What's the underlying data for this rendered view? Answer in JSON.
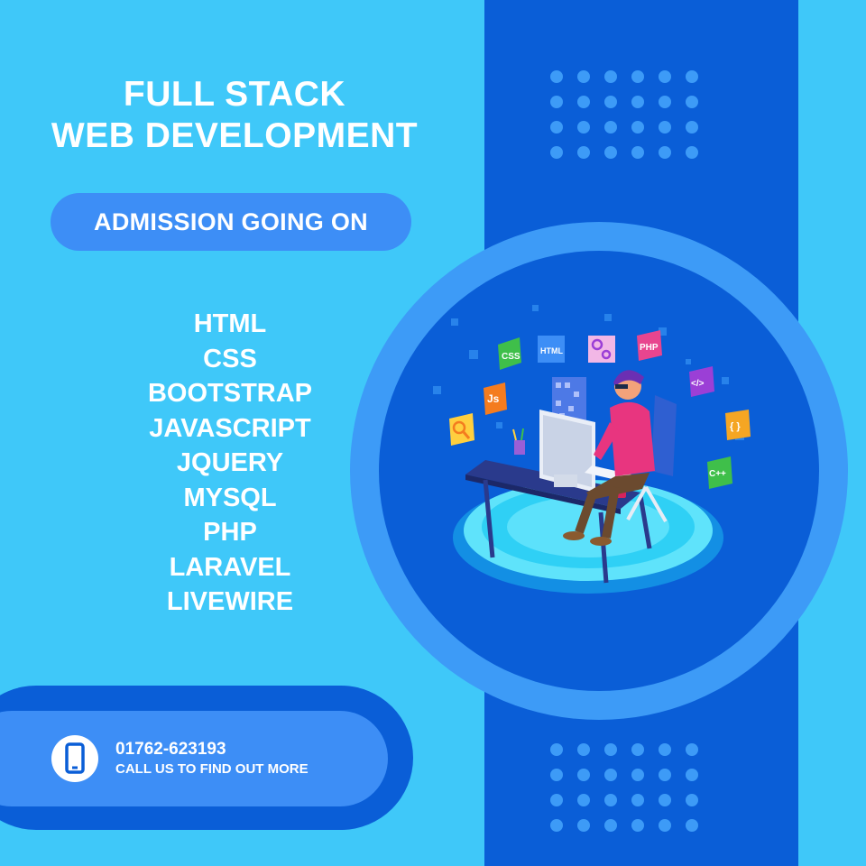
{
  "poster": {
    "title_line1": "FULL STACK",
    "title_line2": "WEB DEVELOPMENT",
    "admission_label": "ADMISSION GOING ON",
    "courses": [
      "HTML",
      "CSS",
      "BOOTSTRAP",
      "JAVASCRIPT",
      "JQUERY",
      "MYSQL",
      "PHP",
      "LARAVEL",
      "LIVEWIRE"
    ],
    "contact": {
      "phone": "01762-623193",
      "cta": "CALL US TO FIND OUT MORE",
      "icon": "mobile-phone-icon"
    },
    "illustration": {
      "badges": [
        {
          "label": "CSS",
          "color": "#3fbf4a"
        },
        {
          "label": "HTML",
          "color": "#3d8ef6"
        },
        {
          "label": "PHP",
          "color": "#e8458f"
        },
        {
          "label": "Js",
          "color": "#f47c1f"
        },
        {
          "label": "</>",
          "color": "#9b3fd6"
        },
        {
          "label": "{ }",
          "color": "#f5a623"
        },
        {
          "label": "C++",
          "color": "#3fbf4a"
        }
      ],
      "icons": [
        "gears-icon",
        "magnifier-icon"
      ]
    },
    "colors": {
      "background": "#3fc8f9",
      "dark_blue": "#0a5ed7",
      "mid_blue": "#3d8ef6",
      "ring_blue": "#3d9bf7"
    }
  }
}
